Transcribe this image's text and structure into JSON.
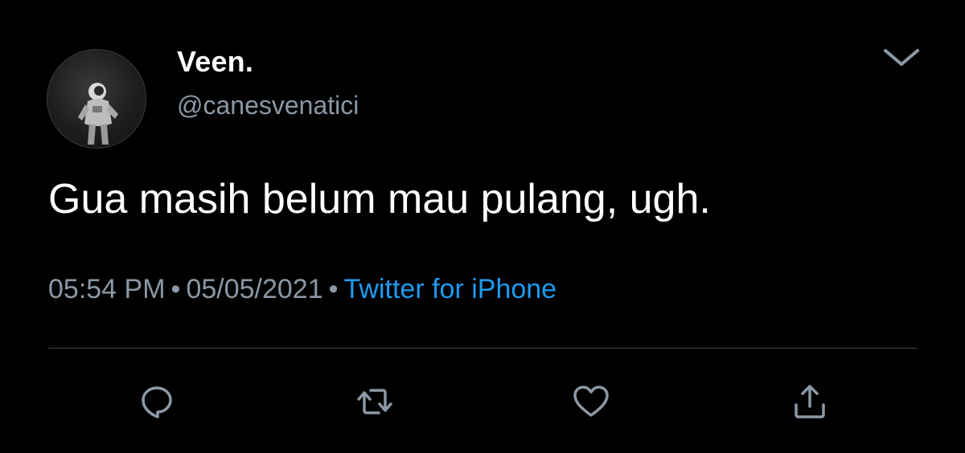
{
  "tweet": {
    "author": {
      "display_name": "Veen.",
      "handle": "@canesvenatici",
      "avatar_icon": "astronaut-avatar"
    },
    "text": "Gua masih belum mau pulang, ugh.",
    "meta": {
      "time": "05:54 PM",
      "separator": "•",
      "date": "05/05/2021",
      "source": "Twitter for iPhone"
    },
    "actions": [
      {
        "name": "reply",
        "icon": "comment-bubble-icon"
      },
      {
        "name": "retweet",
        "icon": "retweet-arrows-icon"
      },
      {
        "name": "like",
        "icon": "heart-icon"
      },
      {
        "name": "share",
        "icon": "share-upload-icon"
      }
    ]
  },
  "theme": {
    "background": "#000000",
    "text": "#ffffff",
    "muted": "#8b98a5",
    "link": "#1d9bf0",
    "divider": "#3d4449"
  }
}
